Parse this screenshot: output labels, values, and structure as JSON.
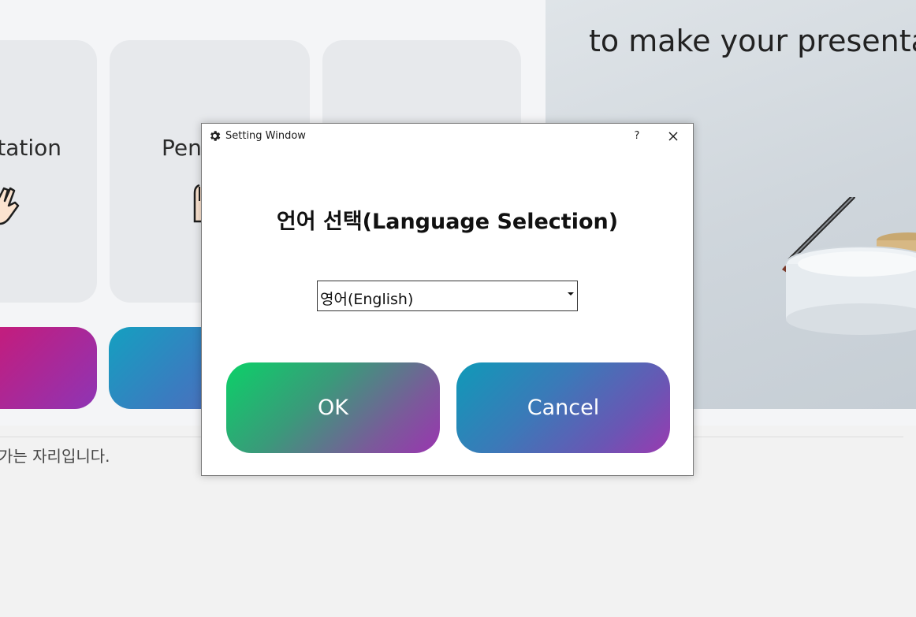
{
  "background": {
    "cards": [
      {
        "label": "ntation"
      },
      {
        "label": "Pen"
      },
      {
        "label": ""
      }
    ],
    "preview_caption": "to make your presentatio",
    "bottom_text": "가는 자리입니다."
  },
  "dialog": {
    "title": "Setting Window",
    "help_label": "?",
    "heading": "언어 선택(Language Selection)",
    "language_select": {
      "value": "영어(English)"
    },
    "ok_label": "OK",
    "cancel_label": "Cancel"
  },
  "colors": {
    "ok_gradient_start": "#0bd168",
    "ok_gradient_end": "#9a35b0",
    "cancel_gradient_start": "#0f9ab8",
    "cancel_gradient_end": "#9a3ab0",
    "mode_button_pink": "#e0176a",
    "mode_button_blue": "#14a0c0"
  },
  "icons": {
    "title": "gear-icon",
    "close": "close-icon",
    "dropdown": "chevron-down-icon",
    "mode_card": "hand-icon"
  }
}
